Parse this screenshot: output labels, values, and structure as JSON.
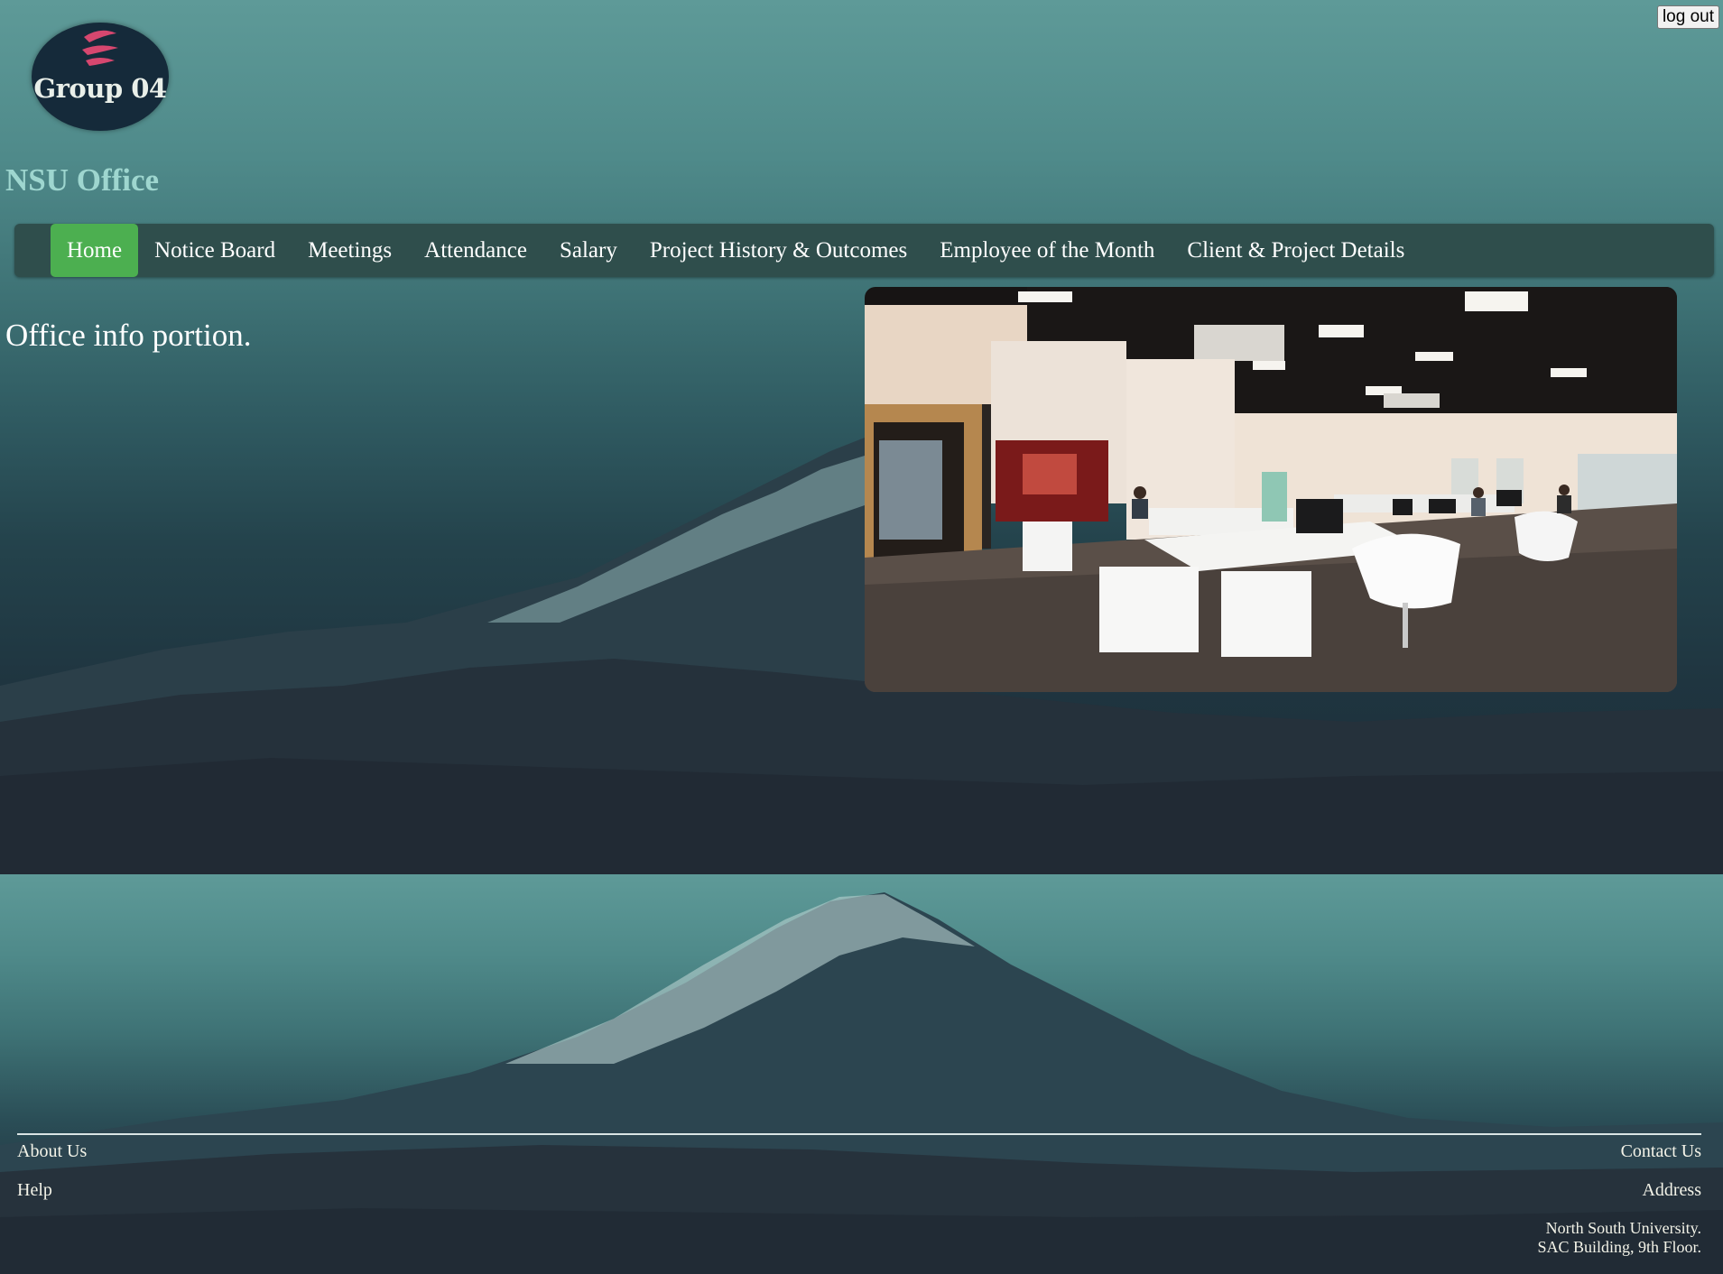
{
  "header": {
    "logout_label": "log out",
    "logo_text": "Group 04",
    "site_title": "NSU Office"
  },
  "nav": {
    "active": "Home",
    "items": [
      {
        "label": "Home"
      },
      {
        "label": "Notice Board"
      },
      {
        "label": "Meetings"
      },
      {
        "label": "Attendance"
      },
      {
        "label": "Salary"
      },
      {
        "label": "Project History & Outcomes"
      },
      {
        "label": "Employee of the Month"
      },
      {
        "label": "Client & Project Details"
      }
    ]
  },
  "main": {
    "info_text": "Office info portion."
  },
  "footer": {
    "about_label": "About Us",
    "help_label": "Help",
    "contact_label": "Contact Us",
    "address_label": "Address",
    "address_line1": "North South University.",
    "address_line2": "SAC Building, 9th Floor."
  },
  "colors": {
    "nav_active": "#4caf50",
    "nav_bg": "#2f4e4c",
    "title_color": "#9ed6cf"
  }
}
